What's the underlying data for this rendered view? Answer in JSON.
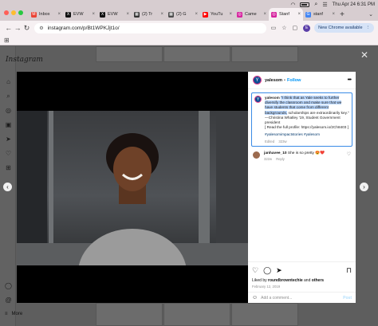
{
  "browser": {
    "tabs": [
      {
        "label": "Inbox",
        "icon": "gmail-icon",
        "color": "#ea4335",
        "glyph": "M",
        "active": false
      },
      {
        "label": "EVW",
        "icon": "x-icon",
        "color": "#111111",
        "glyph": "X",
        "active": false
      },
      {
        "label": "EVW",
        "icon": "x-icon",
        "color": "#111111",
        "glyph": "X",
        "active": false
      },
      {
        "label": "(2) Tr",
        "icon": "app-icon",
        "color": "#333333",
        "glyph": "▦",
        "active": false
      },
      {
        "label": "(2) G",
        "icon": "app-icon",
        "color": "#4c4c4c",
        "glyph": "▦",
        "active": false
      },
      {
        "label": "YouTu",
        "icon": "youtube-icon",
        "color": "#ff0000",
        "glyph": "▶",
        "active": false
      },
      {
        "label": "Came",
        "icon": "instagram-icon",
        "color": "#d6249f",
        "glyph": "◎",
        "active": false
      },
      {
        "label": "Stanf",
        "icon": "instagram-icon",
        "color": "#d6249f",
        "glyph": "◎",
        "active": true
      },
      {
        "label": "stanf",
        "icon": "google-icon",
        "color": "#4285f4",
        "glyph": "G",
        "active": false
      }
    ],
    "new_tab": "+",
    "url": "instagram.com/p/Bt1WPKJjt1o/",
    "update_label": "New Chrome available",
    "profile_initial": "E"
  },
  "menubar": {
    "datetime": "Thu Apr 24 6:31 PM"
  },
  "instagram": {
    "logo": "Instagram",
    "more_label": "More"
  },
  "post": {
    "username": "yalesom",
    "follow": "Follow",
    "caption_user": "yalesom",
    "caption_highlight": "\"I think that as Yale seeks to further diversify the classroom and make sure that we have students that come from different backgrounds,",
    "caption_rest": " scholarships are extraordinarily key.\" —Christina Whatley '19, Student Government president",
    "caption_link": "[ Read the full profile: https://yalesom.io/2Ch8403 ]",
    "hashtags": "#yalesomimpactstories #yalesom",
    "caption_edited": "Edited",
    "caption_age": "323w",
    "comment": {
      "user": "janhavee_10",
      "text": "She is so pretty 😍❤️",
      "age": "322w",
      "reply": "Reply"
    },
    "liked_by_prefix": "Liked by ",
    "liked_by_user": "roundbrowntechie",
    "liked_by_and": " and ",
    "liked_by_others": "others",
    "date": "February 12, 2019",
    "add_comment_placeholder": "Add a comment...",
    "post_button": "Post"
  },
  "colors": {
    "follow": "#0095f6",
    "highlight": "#b9d6fb",
    "update_button": "#d6e3f7"
  }
}
